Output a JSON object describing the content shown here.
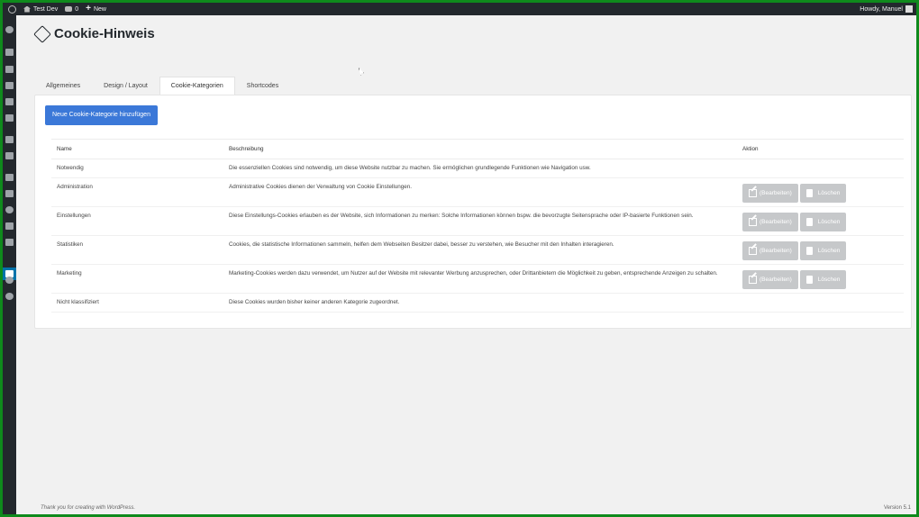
{
  "adminbar": {
    "site_name": "Test Dev",
    "comments_count": "0",
    "new_label": "New",
    "greeting": "Howdy, Manuel"
  },
  "page": {
    "title": "Cookie-Hinweis"
  },
  "tabs": [
    {
      "label": "Allgemeines"
    },
    {
      "label": "Design / Layout"
    },
    {
      "label": "Cookie-Kategorien"
    },
    {
      "label": "Shortcodes"
    }
  ],
  "add_button": "Neue Cookie-Kategorie hinzufügen",
  "table": {
    "headers": {
      "name": "Name",
      "description": "Beschreibung",
      "action": "Aktion"
    },
    "edit_label": "(Bearbeiten)",
    "delete_label": "Löschen",
    "rows": [
      {
        "name": "Notwendig",
        "description": "Die essenziellen Cookies sind notwendig, um diese Website nutzbar zu machen. Sie ermöglichen grundlegende Funktionen wie Navigation usw."
      },
      {
        "name": "Administration",
        "description": "Administrative Cookies dienen der Verwaltung von Cookie Einstellungen."
      },
      {
        "name": "Einstellungen",
        "description": "Diese Einstellungs-Cookies erlauben es der Website, sich Informationen zu merken: Solche Informationen können bspw. die bevorzugte Seitensprache oder IP-basierte Funktionen sein."
      },
      {
        "name": "Statistiken",
        "description": "Cookies, die statistische Informationen sammeln, helfen dem Webseiten Besitzer dabei, besser zu verstehen, wie Besucher mit den Inhalten interagieren."
      },
      {
        "name": "Marketing",
        "description": "Marketing-Cookies werden dazu verwendet, um Nutzer auf der Website mit relevanter Werbung anzusprechen, oder Drittanbietern die Möglichkeit zu geben, entsprechende Anzeigen zu schalten."
      },
      {
        "name": "Nicht klassifiziert",
        "description": "Diese Cookies wurden bisher keiner anderen Kategorie zugeordnet."
      }
    ]
  },
  "footer": {
    "thanks": "Thank you for creating with WordPress.",
    "version": "Version 5.1"
  },
  "colors": {
    "primary_button": "#3b78d8",
    "disabled_button": "#c6c8ca",
    "admin_bar": "#23282d",
    "border": "#0f8a1c"
  }
}
